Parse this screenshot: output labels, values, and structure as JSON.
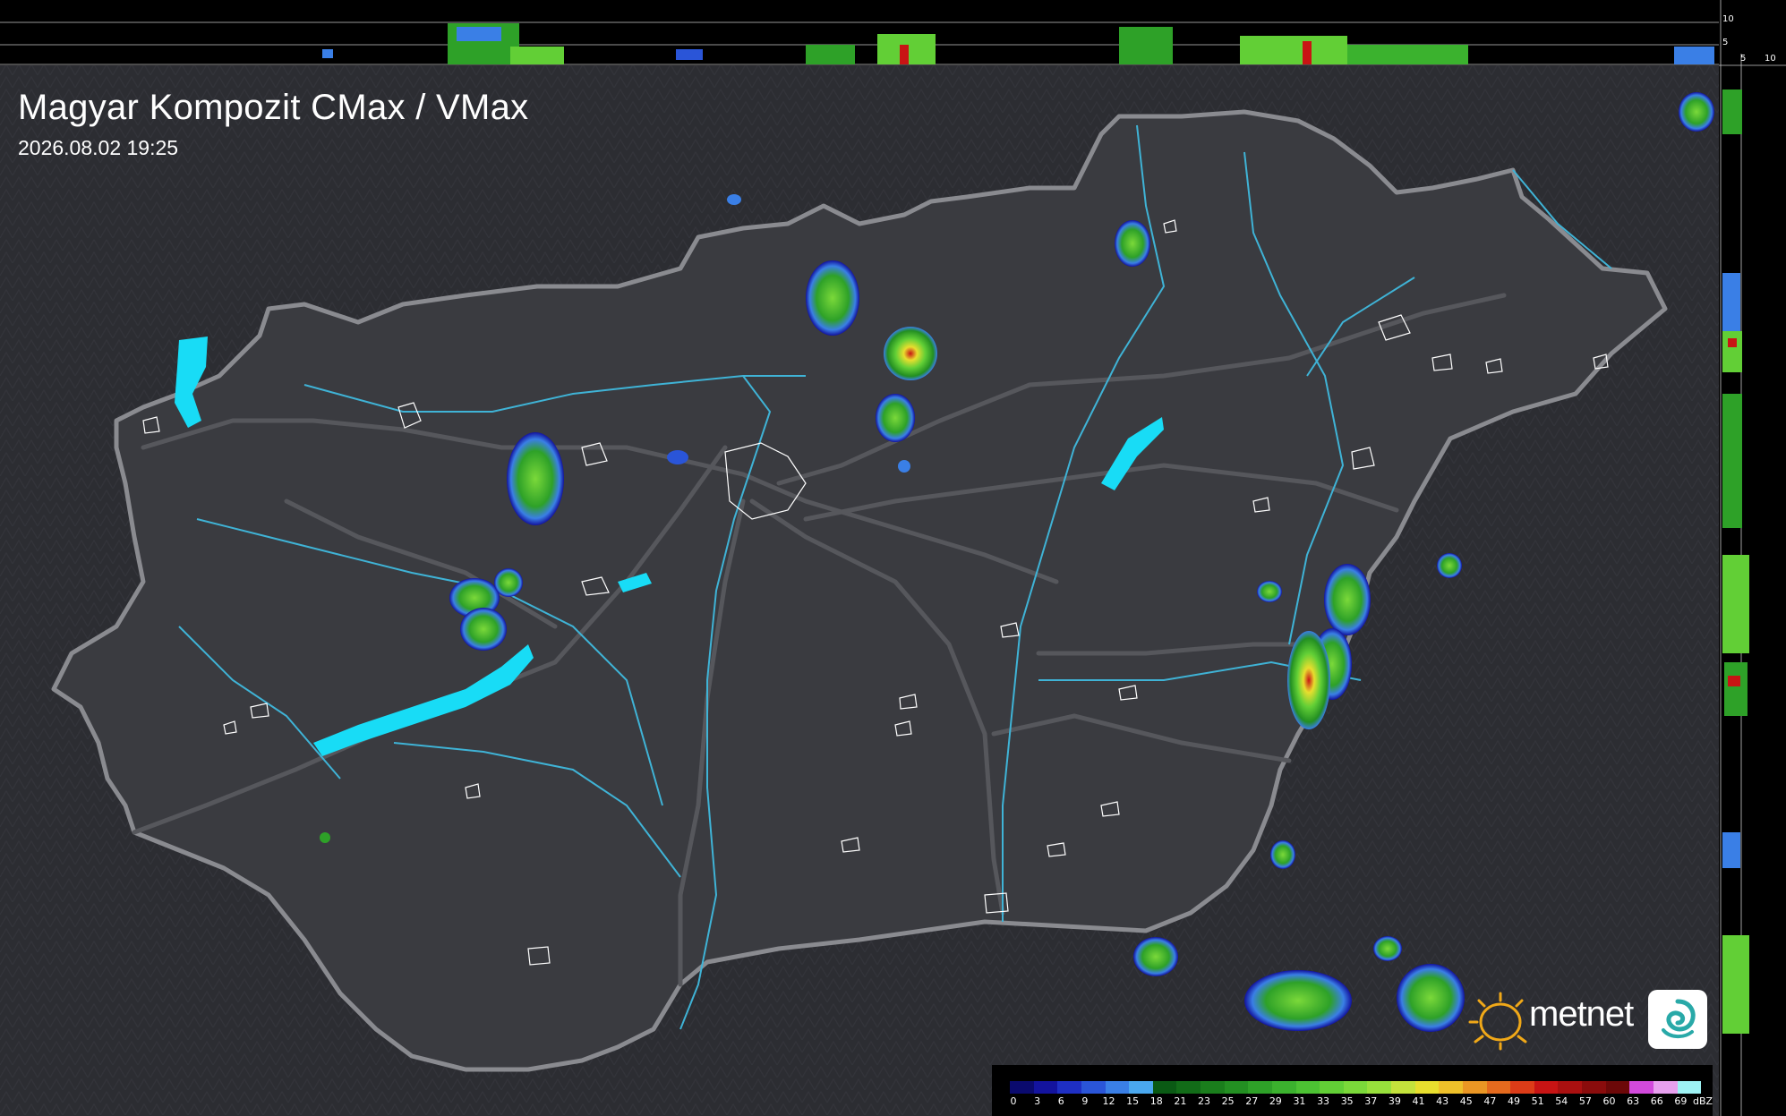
{
  "title": "Magyar Kompozit CMax / VMax",
  "timestamp": "2026.08.02 19:25",
  "profile_axis": {
    "top_ticks": [
      "10",
      "5"
    ],
    "right_ticks": [
      "5",
      "10"
    ]
  },
  "logo": {
    "text": "metnet",
    "icon": "sun-icon"
  },
  "legend": {
    "unit": "dBZ",
    "values": [
      "0",
      "3",
      "6",
      "9",
      "12",
      "15",
      "18",
      "21",
      "23",
      "25",
      "27",
      "29",
      "31",
      "33",
      "35",
      "37",
      "39",
      "41",
      "43",
      "45",
      "47",
      "49",
      "51",
      "54",
      "57",
      "60",
      "63",
      "66",
      "69"
    ],
    "colors": [
      "#0a0a6e",
      "#13139e",
      "#1e2fc4",
      "#2a55d8",
      "#3a7fe6",
      "#4aa8ef",
      "#0a5a14",
      "#126c18",
      "#1a7e1c",
      "#238f22",
      "#2ea128",
      "#3bb22e",
      "#4cc233",
      "#62cf36",
      "#7bd93a",
      "#98e03c",
      "#c4e23c",
      "#e8de2e",
      "#eec02a",
      "#ea9624",
      "#e46a1e",
      "#dc3c18",
      "#c81414",
      "#aa1010",
      "#8a0c0c",
      "#6c0808",
      "#d24adc",
      "#e7a0ee",
      "#9ef2f4"
    ]
  },
  "colors": {
    "background": "#2a2b30",
    "border": "#8a8b90",
    "roads": "#56575c",
    "rivers": "#3fb3d6",
    "lakes": "#18dcf6"
  }
}
